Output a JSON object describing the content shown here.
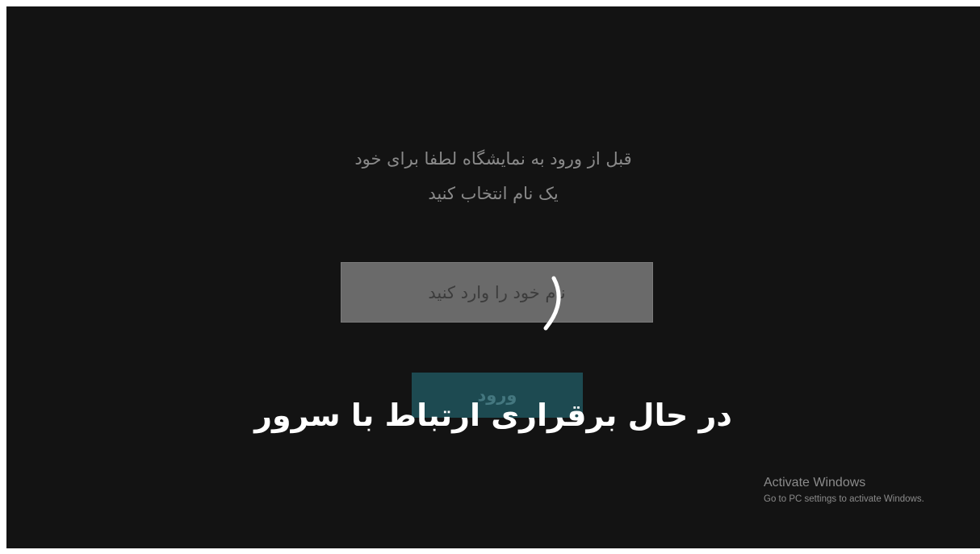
{
  "login": {
    "prompt_line1": "قبل از ورود به نمایشگاه لطفا برای خود",
    "prompt_line2": "یک نام انتخاب کنید",
    "name_placeholder": "نام خود را وارد کنید",
    "name_value": "",
    "enter_label": "ورود"
  },
  "overlay": {
    "status_text": "در حال برقراری ارتباط با سرور",
    "spinner_icon": "loading-spinner-icon"
  },
  "watermark": {
    "title": "Activate Windows",
    "subtitle": "Go to PC settings to activate Windows."
  },
  "colors": {
    "background": "#131313",
    "input_background": "#6a6a6a",
    "button_background": "#1d4a51",
    "overlay_text": "#ffffff"
  }
}
